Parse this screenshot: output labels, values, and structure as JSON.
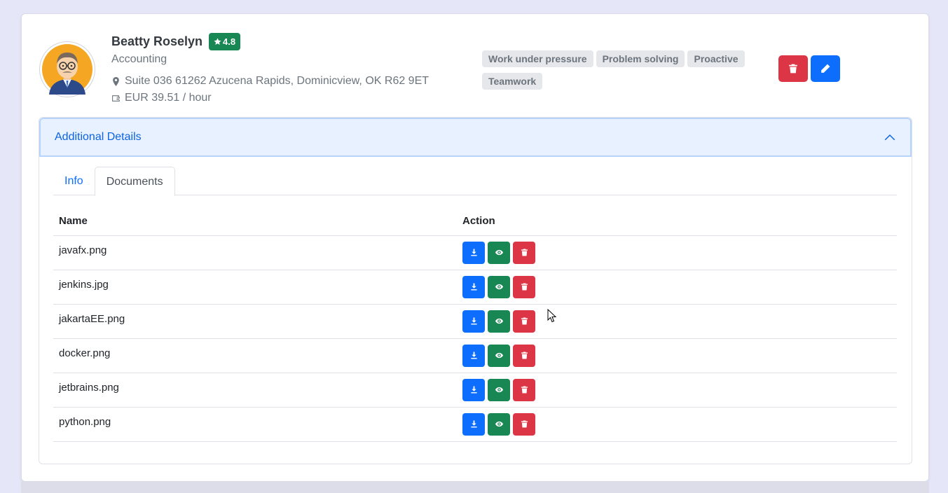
{
  "profile": {
    "name": "Beatty Roselyn",
    "rating": "4.8",
    "department": "Accounting",
    "address": "Suite 036 61262 Azucena Rapids, Dominicview, OK R62 9ET",
    "rate": "EUR 39.51 / hour",
    "skills": [
      "Work under pressure",
      "Problem solving",
      "Proactive",
      "Teamwork"
    ]
  },
  "accordion": {
    "title": "Additional Details"
  },
  "tabs": [
    {
      "label": "Info",
      "active": false
    },
    {
      "label": "Documents",
      "active": true
    }
  ],
  "table": {
    "headers": {
      "name": "Name",
      "action": "Action"
    },
    "rows": [
      {
        "name": "javafx.png"
      },
      {
        "name": "jenkins.jpg"
      },
      {
        "name": "jakartaEE.png"
      },
      {
        "name": "docker.png"
      },
      {
        "name": "jetbrains.png"
      },
      {
        "name": "python.png"
      }
    ]
  },
  "colors": {
    "primary": "#0d6efd",
    "success": "#198754",
    "danger": "#dc3545",
    "background": "#e5e6f7"
  },
  "icons": {
    "location": "map-marker-icon",
    "wallet": "wallet-icon",
    "delete": "trash-icon",
    "edit": "pencil-icon",
    "download": "download-icon",
    "view": "eye-icon",
    "collapse": "chevron-up-icon",
    "rating": "star-icon"
  }
}
